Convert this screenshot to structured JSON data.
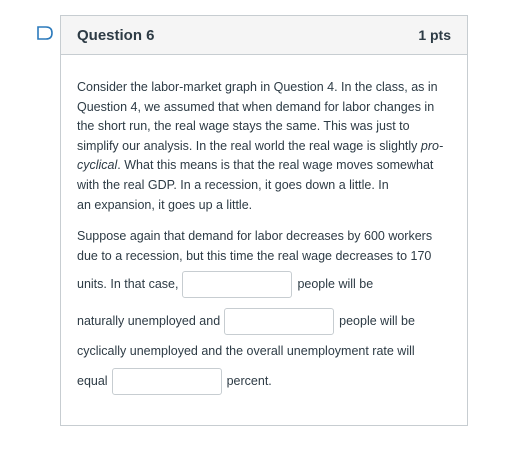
{
  "question": {
    "title": "Question 6",
    "points": "1 pts",
    "paragraph1": {
      "l1": "Consider the labor-market graph in Question 4. In the class, as in",
      "l2": "Question 4, we assumed that when demand for labor changes in",
      "l3": "the short run, the real wage stays the same. This was just to",
      "l4a": "simplify our analysis. In the real world the real wage is slightly ",
      "l4b": "pro-",
      "l5a": "cyclical",
      "l5b": ". What this means is that the real wage moves somewhat",
      "l6": "with the real GDP. In a recession, it goes down a little. In",
      "l7": "an expansion, it goes up a little."
    },
    "paragraph2": {
      "l1": "Suppose again that demand for labor decreases by 600 workers",
      "l2": "due to a recession, but this time the real wage decreases to 170",
      "before_blank1": "units. In that case,",
      "after_blank1": "people will be",
      "before_blank2": "naturally unemployed and",
      "after_blank2": "people will be",
      "l5": "cyclically unemployed and the overall unemployment rate will",
      "before_blank3": "equal",
      "after_blank3": "percent."
    },
    "blanks": {
      "natural_unemployed_value": "",
      "cyclical_unemployed_value": "",
      "unemployment_rate_value": ""
    }
  },
  "colors": {
    "flag_icon": "#2b7abc",
    "header_bg": "#f5f5f5",
    "border": "#c7cdd1",
    "text": "#2d3b45"
  }
}
